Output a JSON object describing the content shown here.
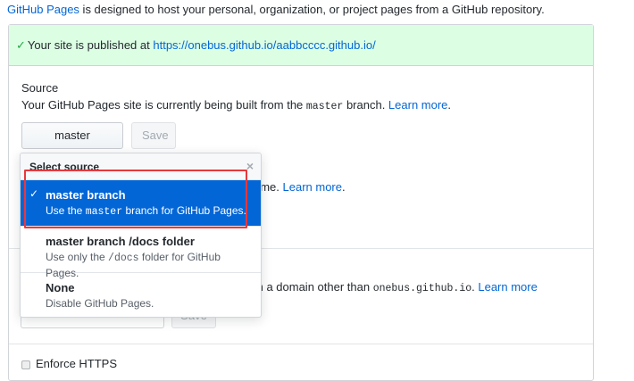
{
  "intro": {
    "link": "GitHub Pages",
    "text": " is designed to host your personal, organization, or project pages from a GitHub repository."
  },
  "flash": {
    "prefix": "Your site is published at ",
    "url": "https://onebus.github.io/aabbcccc.github.io/"
  },
  "source": {
    "title": "Source",
    "desc_before": "Your GitHub Pages site is currently being built from the ",
    "desc_code": "master",
    "desc_after": " branch. ",
    "learn_more": "Learn more",
    "select_label": "master branch",
    "save_label": "Save"
  },
  "behind": {
    "theme_text": "eme. ",
    "theme_learn_more": "Learn more",
    "domain_text": "m a domain other than ",
    "domain_code": "onebus.github.io",
    "domain_after": ". ",
    "domain_learn_more": "Learn more",
    "save2": "Save",
    "enforce": "Enforce HTTPS"
  },
  "dropdown": {
    "header": "Select source",
    "items": [
      {
        "title": "master branch",
        "desc_before": "Use the ",
        "desc_code": "master",
        "desc_after": " branch for GitHub Pages.",
        "selected": true
      },
      {
        "title": "master branch /docs folder",
        "desc_before": "Use only the ",
        "desc_code": "/docs",
        "desc_after": " folder for GitHub Pages.",
        "selected": false
      },
      {
        "title": "None",
        "desc_before": "Disable GitHub Pages.",
        "desc_code": "",
        "desc_after": "",
        "selected": false
      }
    ]
  },
  "colors": {
    "accent": "#0366d6",
    "success_bg": "#dcffe4",
    "highlight": "#e8383d"
  }
}
